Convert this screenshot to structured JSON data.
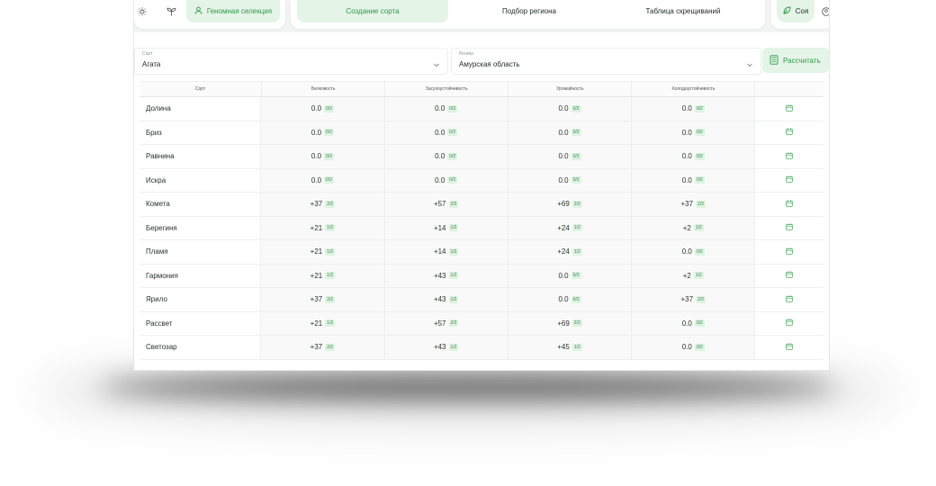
{
  "nav": {
    "items": [
      {
        "id": "genomic",
        "label": "Геномная селекция",
        "icon": "person-icon",
        "active": true
      },
      {
        "id": "create",
        "label": "Создание сорта",
        "active": true
      },
      {
        "id": "region",
        "label": "Подбор региона",
        "active": false
      },
      {
        "id": "crosses",
        "label": "Таблица скрещиваний",
        "active": false
      }
    ],
    "crop": {
      "label": "Соя",
      "icon": "leaf-icon"
    }
  },
  "form": {
    "variety": {
      "label": "Сорт",
      "value": "Агата"
    },
    "region": {
      "label": "Регион",
      "value": "Амурская область"
    },
    "calculate_label": "Рассчитать"
  },
  "table": {
    "columns": [
      "Сорт",
      "Белковость",
      "Засухоустойчивость",
      "Урожайность",
      "Холодоустойчивость"
    ],
    "rows": [
      {
        "name": "Долина",
        "cells": [
          [
            "0.0",
            "0/2"
          ],
          [
            "0.0",
            "0/2"
          ],
          [
            "0.0",
            "0/2"
          ],
          [
            "0.0",
            "0/2"
          ]
        ]
      },
      {
        "name": "Бриз",
        "cells": [
          [
            "0.0",
            "0/2"
          ],
          [
            "0.0",
            "0/2"
          ],
          [
            "0.0",
            "0/2"
          ],
          [
            "0.0",
            "0/2"
          ]
        ]
      },
      {
        "name": "Равнина",
        "cells": [
          [
            "0.0",
            "0/2"
          ],
          [
            "0.0",
            "0/2"
          ],
          [
            "0.0",
            "0/2"
          ],
          [
            "0.0",
            "0/2"
          ]
        ]
      },
      {
        "name": "Искра",
        "cells": [
          [
            "0.0",
            "0/2"
          ],
          [
            "0.0",
            "0/2"
          ],
          [
            "0.0",
            "0/2"
          ],
          [
            "0.0",
            "0/2"
          ]
        ]
      },
      {
        "name": "Комета",
        "cells": [
          [
            "+37",
            "2/2"
          ],
          [
            "+57",
            "2/2"
          ],
          [
            "+69",
            "2/2"
          ],
          [
            "+37",
            "2/2"
          ]
        ]
      },
      {
        "name": "Берегиня",
        "cells": [
          [
            "+21",
            "1/2"
          ],
          [
            "+14",
            "1/2"
          ],
          [
            "+24",
            "1/2"
          ],
          [
            "+2",
            "1/2"
          ]
        ]
      },
      {
        "name": "Пламя",
        "cells": [
          [
            "+21",
            "1/2"
          ],
          [
            "+14",
            "1/2"
          ],
          [
            "+24",
            "1/2"
          ],
          [
            "0.0",
            "0/2"
          ]
        ]
      },
      {
        "name": "Гармония",
        "cells": [
          [
            "+21",
            "1/2"
          ],
          [
            "+43",
            "1/2"
          ],
          [
            "0.0",
            "0/2"
          ],
          [
            "+2",
            "1/2"
          ]
        ]
      },
      {
        "name": "Ярило",
        "cells": [
          [
            "+37",
            "2/2"
          ],
          [
            "+43",
            "1/2"
          ],
          [
            "0.0",
            "0/2"
          ],
          [
            "+37",
            "2/2"
          ]
        ]
      },
      {
        "name": "Рассвет",
        "cells": [
          [
            "+21",
            "1/2"
          ],
          [
            "+57",
            "2/2"
          ],
          [
            "+69",
            "2/2"
          ],
          [
            "0.0",
            "0/2"
          ]
        ]
      },
      {
        "name": "Светозар",
        "cells": [
          [
            "+37",
            "2/2"
          ],
          [
            "+43",
            "1/2"
          ],
          [
            "+45",
            "1/2"
          ],
          [
            "0.0",
            "0/2"
          ]
        ]
      }
    ],
    "row_action_icon": "calendar-icon"
  },
  "colors": {
    "accent": "#2f9a4a",
    "accent_bg": "#e4f4e7",
    "badge_bg": "#dff1e2"
  }
}
